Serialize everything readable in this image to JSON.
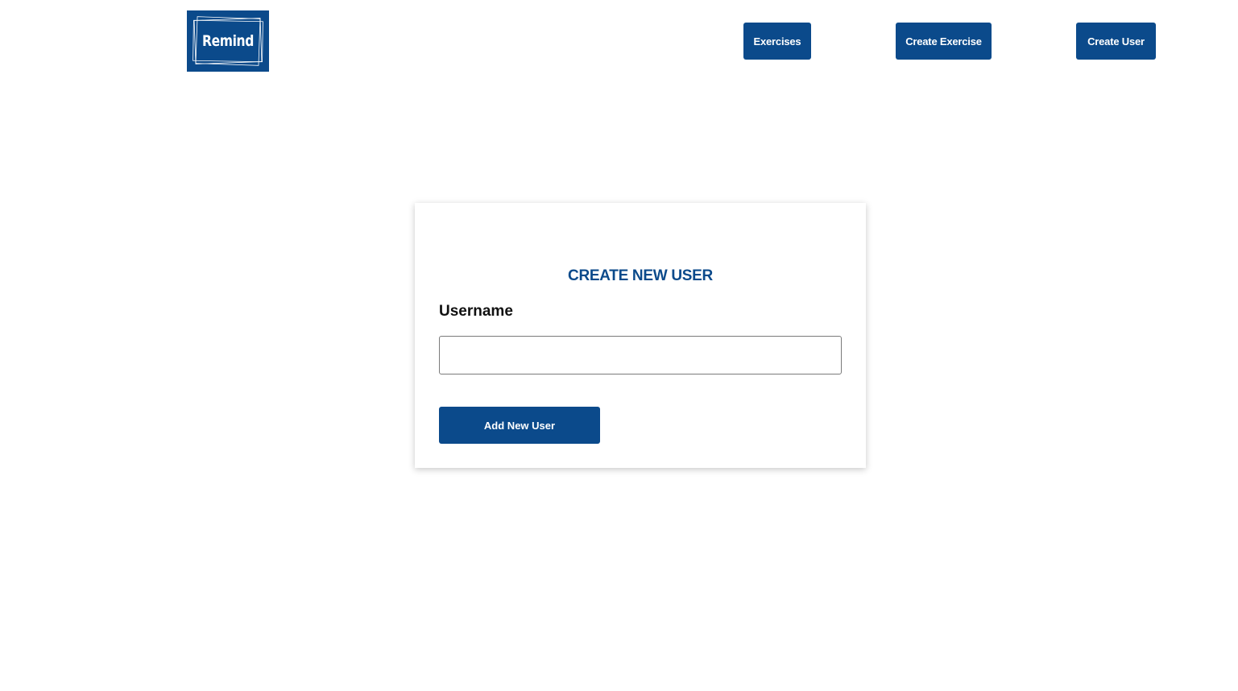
{
  "header": {
    "logo_text": "Remind",
    "nav": [
      {
        "label": "Exercises"
      },
      {
        "label": "Create Exercise"
      },
      {
        "label": "Create User"
      }
    ]
  },
  "form": {
    "title": "CREATE NEW USER",
    "username_label": "Username",
    "username_value": "",
    "username_placeholder": "",
    "submit_label": "Add New User"
  },
  "colors": {
    "brand": "#0b4a8b",
    "background": "#ffffff",
    "label_text": "#111111",
    "input_border": "#7a7a7a"
  }
}
